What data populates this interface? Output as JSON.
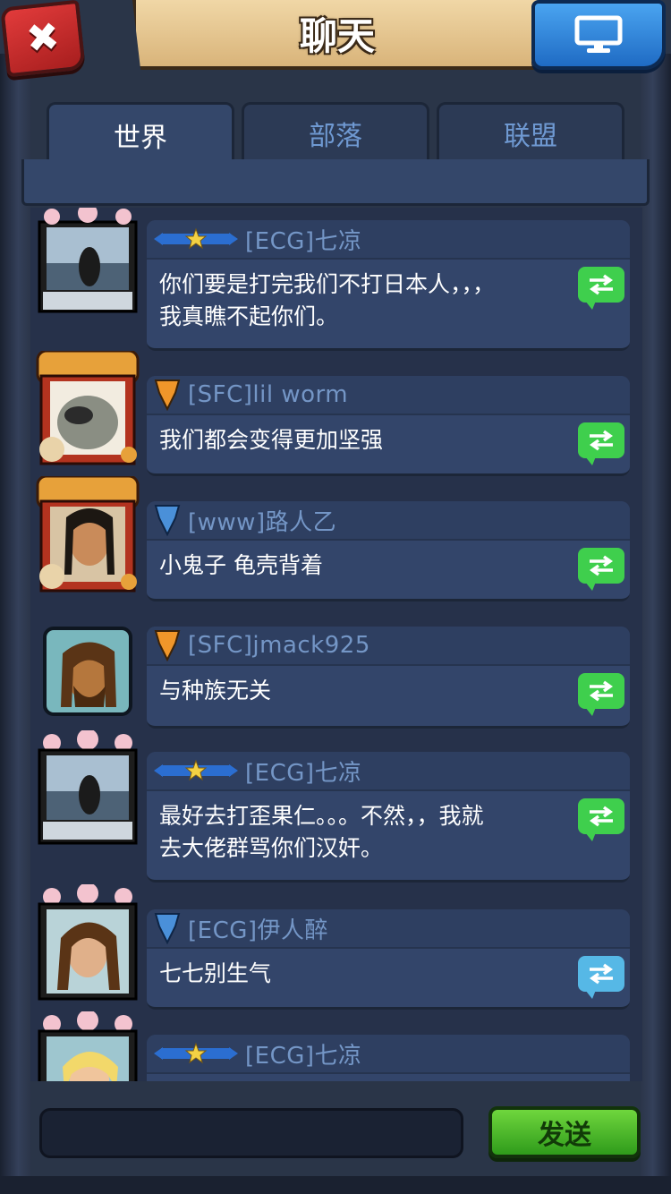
{
  "header": {
    "title": "聊天",
    "close_icon": "close-x-icon",
    "screen_icon": "monitor-icon"
  },
  "tabs": [
    {
      "label": "世界",
      "active": true
    },
    {
      "label": "部落",
      "active": false
    },
    {
      "label": "联盟",
      "active": false
    }
  ],
  "messages": [
    {
      "badge": "blue-ribbon-star",
      "name": "[ECG]七凉",
      "lines": [
        "你们要是打完我们不打日本人，，，",
        "我真瞧不起你们。"
      ],
      "forward_color": "green",
      "avatar": "lake-sakura-frame"
    },
    {
      "badge": "orange-shield",
      "name": "[SFC]lil worm",
      "lines": [
        "我们都会变得更加坚强"
      ],
      "forward_color": "green",
      "avatar": "beast-tiger-frame"
    },
    {
      "badge": "blue-shield",
      "name": "[www]路人乙",
      "lines": [
        "小鬼子 龟壳背着"
      ],
      "forward_color": "green",
      "avatar": "warrior-tiger-frame"
    },
    {
      "badge": "orange-shield",
      "name": "[SFC]jmack925",
      "lines": [
        "与种族无关"
      ],
      "forward_color": "green",
      "avatar": "bearded-warrior-plain"
    },
    {
      "badge": "blue-ribbon-star",
      "name": "[ECG]七凉",
      "lines": [
        "最好去打歪果仁。。。不然，，我就",
        "去大佬群骂你们汉奸。"
      ],
      "forward_color": "green",
      "avatar": "lake-sakura-frame"
    },
    {
      "badge": "blue-shield",
      "name": "[ECG]伊人醉",
      "lines": [
        "七七别生气"
      ],
      "forward_color": "blue",
      "avatar": "woman-sakura-frame"
    },
    {
      "badge": "blue-ribbon-star",
      "name": "[ECG]七凉",
      "lines": [],
      "forward_color": "green",
      "avatar": "blonde-sakura-frame"
    }
  ],
  "input": {
    "placeholder": ""
  },
  "send_label": "发送",
  "colors": {
    "name_text": "#7496c6",
    "bubble_bg": "#33456a",
    "send_green": "#3fcf4d",
    "tab_inactive_text": "#6f99d2"
  }
}
